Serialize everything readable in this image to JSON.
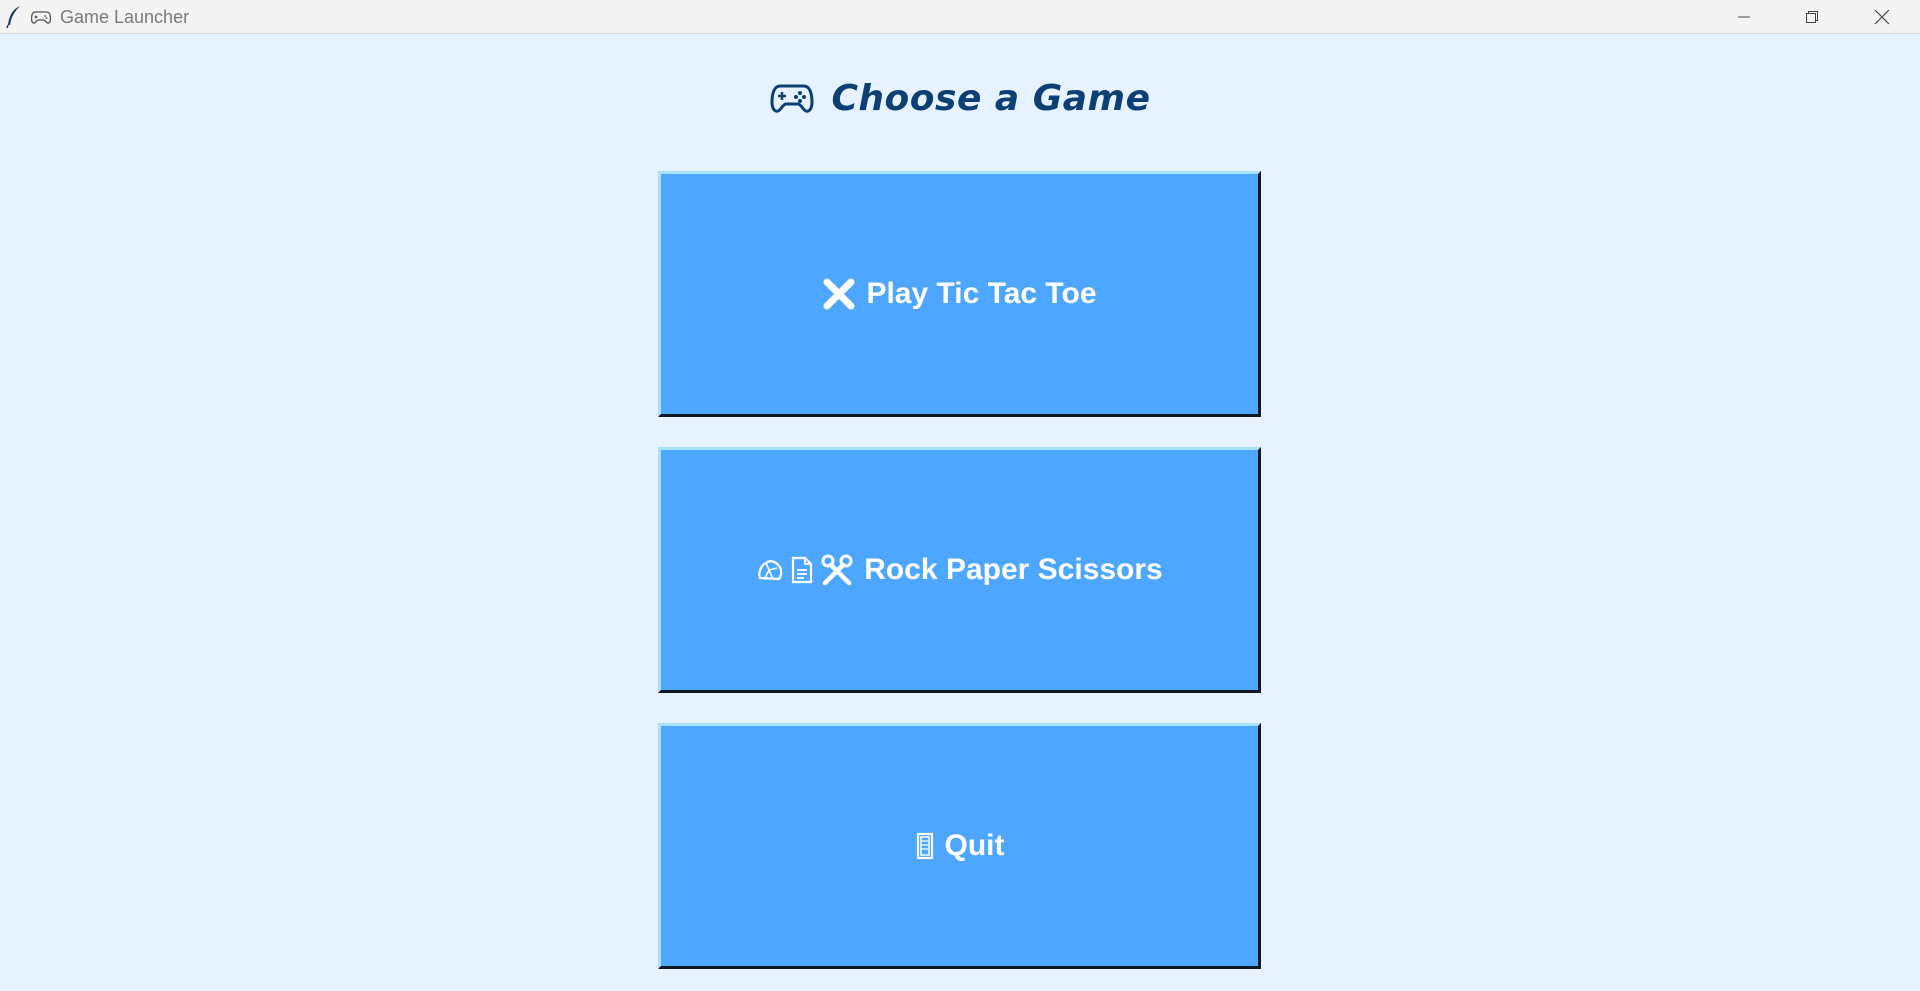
{
  "window": {
    "title": "Game Launcher",
    "title_icon": "gamepad-icon",
    "app_icon": "feather-icon",
    "controls": [
      "minimize-icon",
      "restore-icon",
      "close-icon"
    ]
  },
  "heading": {
    "icon": "gamepad-icon",
    "text": "Choose a Game"
  },
  "buttons": {
    "tic_tac_toe": {
      "icon": "x-mark-icon",
      "label": "Play Tic Tac Toe"
    },
    "rps": {
      "icons": [
        "rock-icon",
        "paper-icon",
        "scissors-icon"
      ],
      "label": "Rock Paper Scissors"
    },
    "quit": {
      "icon": "door-icon",
      "label": "Quit"
    }
  },
  "colors": {
    "background": "#e6f2ff",
    "button": "#4da6ff",
    "heading": "#0c3f73",
    "button_text": "#ffffff"
  }
}
